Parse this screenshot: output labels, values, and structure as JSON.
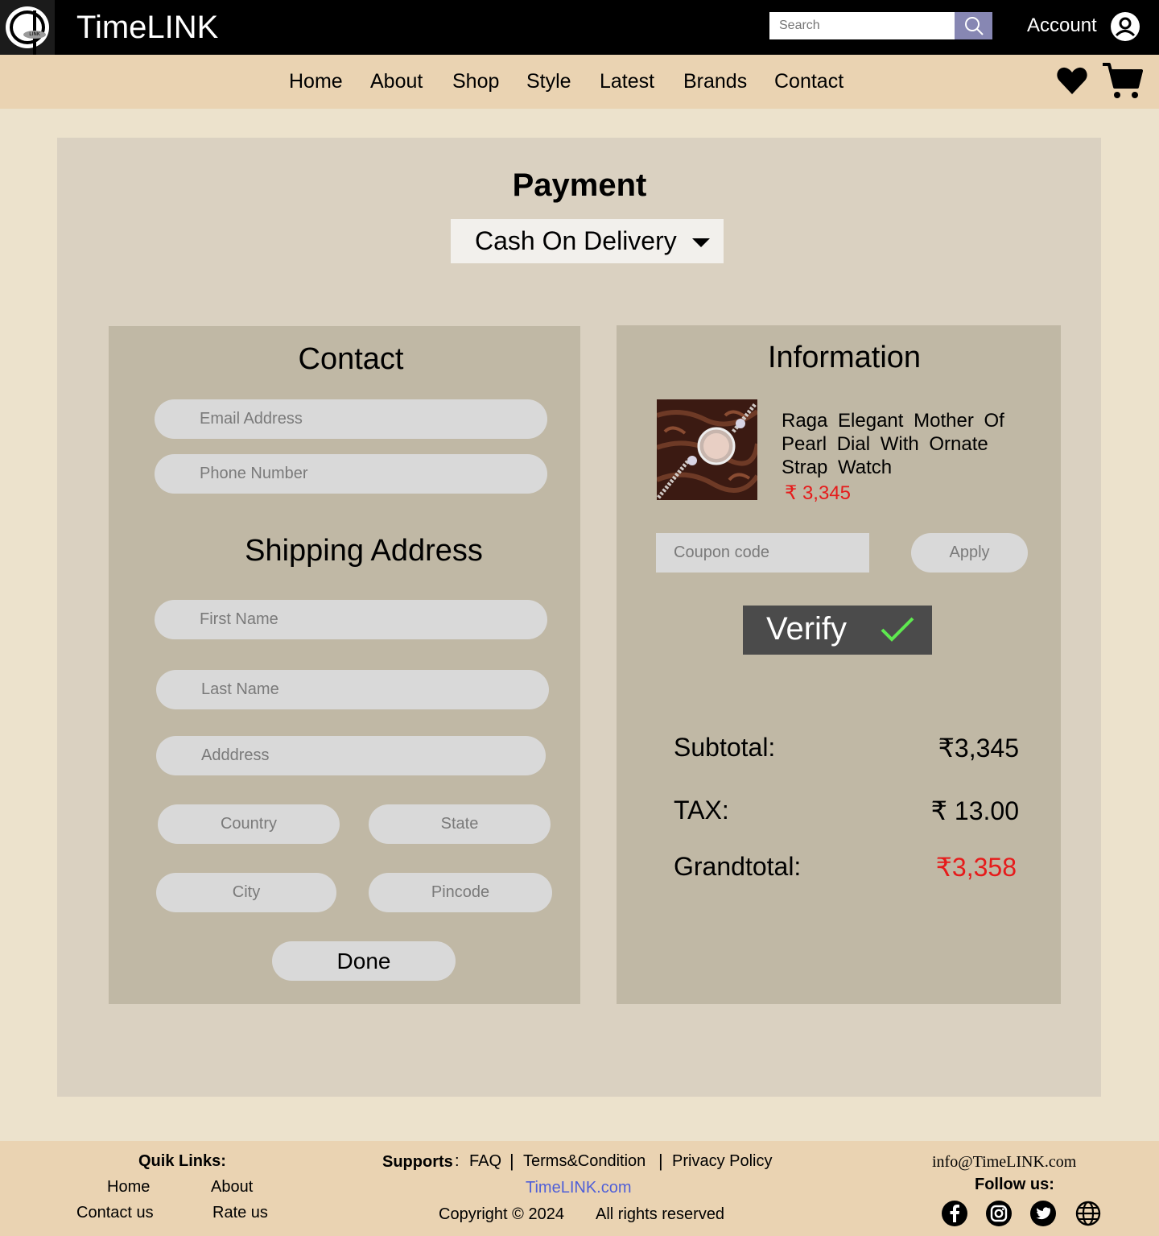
{
  "header": {
    "logo_text": "LINK",
    "brand": "TimeLINK",
    "search_placeholder": "Search",
    "account_label": "Account"
  },
  "nav": {
    "items": [
      "Home",
      "About",
      "Shop",
      "Style",
      "Latest",
      "Brands",
      "Contact"
    ]
  },
  "payment": {
    "title": "Payment",
    "method": "Cash On Delivery"
  },
  "contact": {
    "title": "Contact",
    "email_placeholder": "Email Address",
    "phone_placeholder": "Phone Number"
  },
  "shipping": {
    "title": "Shipping Address",
    "first_name_placeholder": "First Name",
    "last_name_placeholder": "Last Name",
    "address_placeholder": "Adddress",
    "country_placeholder": "Country",
    "state_placeholder": "State",
    "city_placeholder": "City",
    "pincode_placeholder": "Pincode",
    "done_label": "Done"
  },
  "information": {
    "title": "Information",
    "product_name": "Raga Elegant Mother Of Pearl Dial With Ornate Strap Watch",
    "product_price": "₹ 3,345",
    "coupon_placeholder": "Coupon code",
    "apply_label": "Apply",
    "verify_label": "Verify",
    "subtotal_label": "Subtotal:",
    "subtotal_value": "₹3,345",
    "tax_label": "TAX:",
    "tax_value": "₹ 13.00",
    "grandtotal_label": "Grandtotal:",
    "grandtotal_value": "₹3,358"
  },
  "footer": {
    "quick_links_title": "Quik Links:",
    "quick_links": [
      "Home",
      "About",
      "Contact us",
      "Rate us"
    ],
    "supports_label": "Supports",
    "supports_sep": ":",
    "faq": "FAQ",
    "terms": "Terms&Condition",
    "privacy": "Privacy Policy",
    "website": "TimeLINK.com",
    "copyright": "Copyright © 2024",
    "rights": "All rights reserved",
    "email": "info@TimeLINK.com",
    "follow": "Follow us:",
    "social_icons": [
      "facebook-icon",
      "instagram-icon",
      "twitter-icon",
      "globe-icon"
    ]
  },
  "colors": {
    "accent_price": "#e61b1b",
    "verify_check": "#5ee84f",
    "link_blue": "#4f5fd8"
  }
}
